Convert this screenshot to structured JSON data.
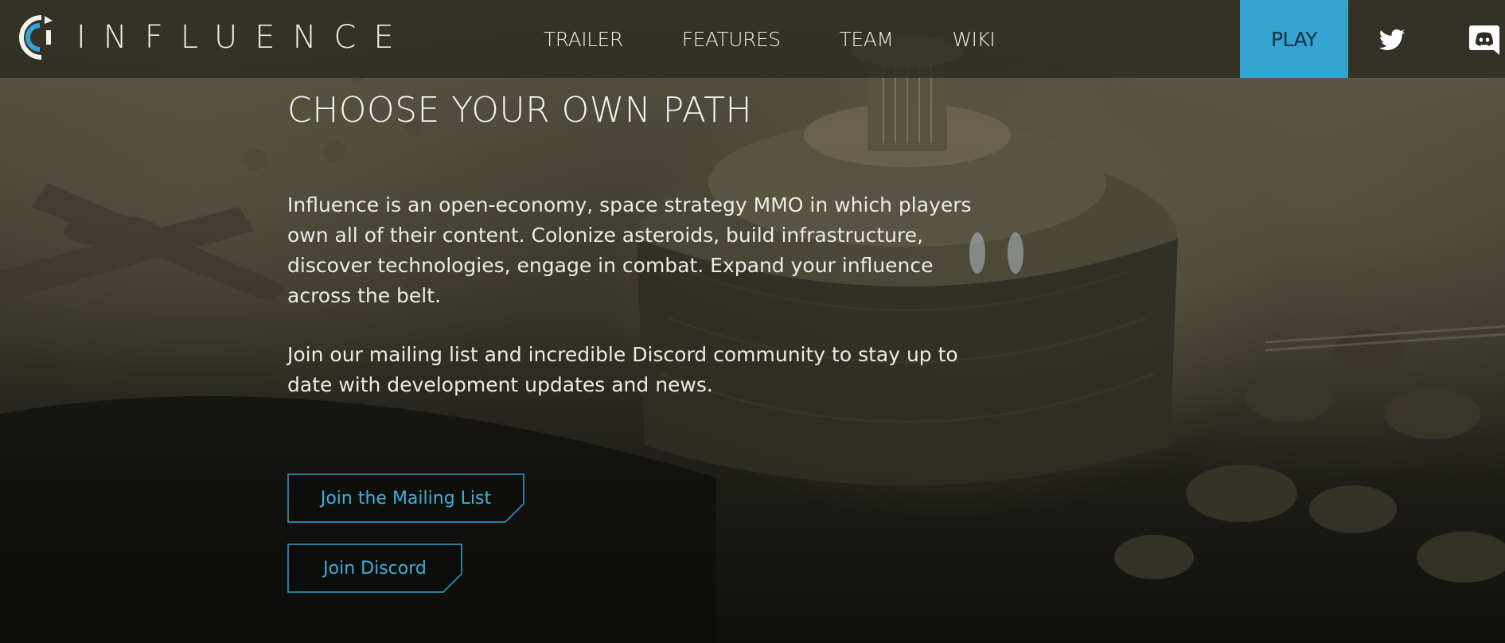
{
  "brand": {
    "name": "INFLUENCE",
    "logo_icon": "influence-logo-icon"
  },
  "nav": {
    "items": [
      {
        "label": "TRAILER"
      },
      {
        "label": "FEATURES"
      },
      {
        "label": "TEAM"
      },
      {
        "label": "WIKI"
      }
    ],
    "play_label": "PLAY",
    "social": [
      {
        "icon": "twitter-icon"
      },
      {
        "icon": "discord-icon"
      }
    ]
  },
  "colors": {
    "accent": "#33a3d2",
    "button_text": "#3fb0de",
    "nav_bg": "#2c2a21"
  },
  "hero": {
    "title": "CHOOSE YOUR OWN PATH",
    "paragraph_1": "Influence is an open-economy, space strategy MMO in which players own all of their content. Colonize asteroids, build infrastructure, discover technologies, engage in combat. Expand your influence across the belt.",
    "paragraph_2": "Join our mailing list and incredible Discord community to stay up to date with development updates and news.",
    "buttons": {
      "mailing_list": "Join the Mailing List",
      "discord": "Join Discord"
    }
  }
}
